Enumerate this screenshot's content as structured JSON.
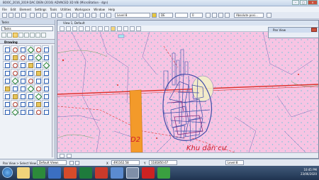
{
  "window": {
    "title": "BOOC_2016_2019 DAC DIEN (2016) ADVNCED 3D V8i (MicroStation - dgn)"
  },
  "menu": [
    "File",
    "Edit",
    "Element",
    "Settings",
    "Tools",
    "Utilities",
    "Workspace",
    "Window",
    "Help"
  ],
  "toolbar": {
    "level": "Level 8",
    "color_value": "DE",
    "weight": "0",
    "style": "Absolute posi..."
  },
  "tasks": {
    "header": "Tasks",
    "dropdown": "Tasks",
    "section": "Drawing"
  },
  "view": {
    "title": "View 1, Default"
  },
  "map": {
    "label_d2": "D2",
    "label_residential": "Khu dân cư",
    "colors": {
      "background": "#f7c4e3",
      "road": "#e0342e",
      "orange_strip": "#f39a2a",
      "cadastral": "#3e4aa8",
      "vegetation_dots": "#5cc5d6",
      "green": "#4c9a3e"
    }
  },
  "panview": {
    "title": "Pan View"
  },
  "status": {
    "message": "Pan View > Select View",
    "view_select": "Default Views",
    "x_label": "X",
    "x_value": "491162.58",
    "y_label": "Y",
    "y_value": "1181850.67",
    "level": "Level 8"
  },
  "taskbar": {
    "time": "10:45 PM",
    "date": "23/06/2020"
  }
}
